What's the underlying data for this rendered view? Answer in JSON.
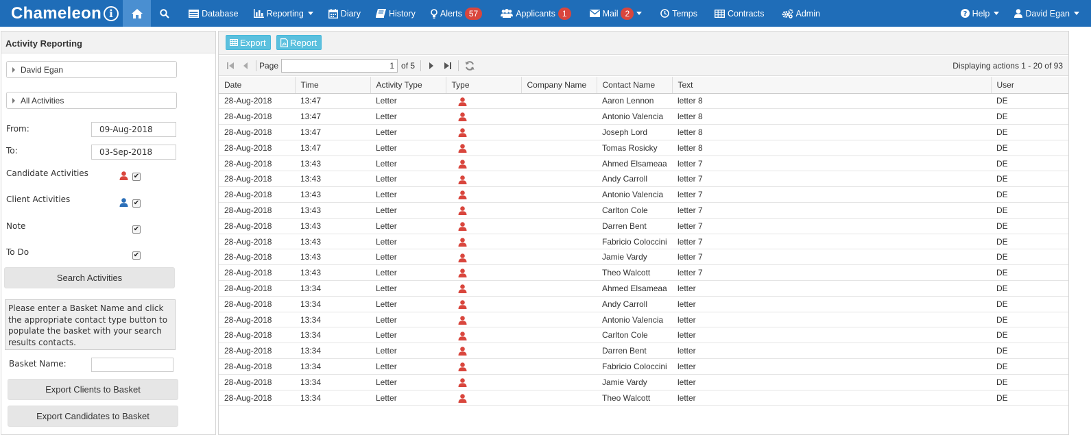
{
  "navbar": {
    "brand": "Chameleon",
    "brand_icon": "i",
    "items": [
      {
        "label": "Database"
      },
      {
        "label": "Reporting"
      },
      {
        "label": "Diary"
      },
      {
        "label": "History"
      },
      {
        "label": "Alerts",
        "badge": "57"
      },
      {
        "label": "Applicants",
        "badge": "1"
      },
      {
        "label": "Mail",
        "badge": "2"
      },
      {
        "label": "Temps"
      },
      {
        "label": "Contracts"
      },
      {
        "label": "Admin"
      }
    ],
    "help_label": "Help",
    "user_label": "David Egan"
  },
  "colors": {
    "navbar": "#1f6db8",
    "badge": "#d9463d",
    "candidate_icon": "#d9463d",
    "client_icon": "#2c6fb8",
    "toolbar_button": "#5bc0de"
  },
  "left_panel": {
    "title": "Activity Reporting",
    "user_combo": "David Egan",
    "activity_combo": "All Activities",
    "from_label": "From:",
    "from_value": "09-Aug-2018",
    "to_label": "To:",
    "to_value": "03-Sep-2018",
    "candidate_label": "Candidate Activities",
    "client_label": "Client Activities",
    "note_label": "Note",
    "todo_label": "To Do",
    "search_button": "Search Activities",
    "info_text": "Please enter a Basket Name and click the appropriate contact type button to populate the basket with your search results contacts.",
    "basket_label": "Basket Name:",
    "basket_value": "",
    "export_clients_button": "Export Clients to Basket",
    "export_candidates_button": "Export Candidates to Basket"
  },
  "toolbar": {
    "export_label": "Export",
    "report_label": "Report"
  },
  "pager": {
    "page_label": "Page",
    "page_value": "1",
    "of_label": "of 5",
    "display_text": "Displaying actions 1 - 20 of 93"
  },
  "grid": {
    "columns": [
      "Date",
      "Time",
      "Activity Type",
      "Type",
      "Company Name",
      "Contact Name",
      "Text",
      "User"
    ],
    "rows": [
      {
        "date": "28-Aug-2018",
        "time": "13:47",
        "activity": "Letter",
        "type": "candidate-icon",
        "company": "",
        "contact": "Aaron Lennon",
        "text": "letter 8",
        "user": "DE"
      },
      {
        "date": "28-Aug-2018",
        "time": "13:47",
        "activity": "Letter",
        "type": "candidate-icon",
        "company": "",
        "contact": "Antonio Valencia",
        "text": "letter 8",
        "user": "DE"
      },
      {
        "date": "28-Aug-2018",
        "time": "13:47",
        "activity": "Letter",
        "type": "candidate-icon",
        "company": "",
        "contact": "Joseph Lord",
        "text": "letter 8",
        "user": "DE"
      },
      {
        "date": "28-Aug-2018",
        "time": "13:47",
        "activity": "Letter",
        "type": "candidate-icon",
        "company": "",
        "contact": "Tomas Rosicky",
        "text": "letter 8",
        "user": "DE"
      },
      {
        "date": "28-Aug-2018",
        "time": "13:43",
        "activity": "Letter",
        "type": "candidate-icon",
        "company": "",
        "contact": "Ahmed Elsameaa",
        "text": "letter 7",
        "user": "DE"
      },
      {
        "date": "28-Aug-2018",
        "time": "13:43",
        "activity": "Letter",
        "type": "candidate-icon",
        "company": "",
        "contact": "Andy Carroll",
        "text": "letter 7",
        "user": "DE"
      },
      {
        "date": "28-Aug-2018",
        "time": "13:43",
        "activity": "Letter",
        "type": "candidate-icon",
        "company": "",
        "contact": "Antonio Valencia",
        "text": "letter 7",
        "user": "DE"
      },
      {
        "date": "28-Aug-2018",
        "time": "13:43",
        "activity": "Letter",
        "type": "candidate-icon",
        "company": "",
        "contact": "Carlton Cole",
        "text": "letter 7",
        "user": "DE"
      },
      {
        "date": "28-Aug-2018",
        "time": "13:43",
        "activity": "Letter",
        "type": "candidate-icon",
        "company": "",
        "contact": "Darren Bent",
        "text": "letter 7",
        "user": "DE"
      },
      {
        "date": "28-Aug-2018",
        "time": "13:43",
        "activity": "Letter",
        "type": "candidate-icon",
        "company": "",
        "contact": "Fabricio Coloccini",
        "text": "letter 7",
        "user": "DE"
      },
      {
        "date": "28-Aug-2018",
        "time": "13:43",
        "activity": "Letter",
        "type": "candidate-icon",
        "company": "",
        "contact": "Jamie Vardy",
        "text": "letter 7",
        "user": "DE"
      },
      {
        "date": "28-Aug-2018",
        "time": "13:43",
        "activity": "Letter",
        "type": "candidate-icon",
        "company": "",
        "contact": "Theo Walcott",
        "text": "letter 7",
        "user": "DE"
      },
      {
        "date": "28-Aug-2018",
        "time": "13:34",
        "activity": "Letter",
        "type": "candidate-icon",
        "company": "",
        "contact": "Ahmed Elsameaa",
        "text": "letter",
        "user": "DE"
      },
      {
        "date": "28-Aug-2018",
        "time": "13:34",
        "activity": "Letter",
        "type": "candidate-icon",
        "company": "",
        "contact": "Andy Carroll",
        "text": "letter",
        "user": "DE"
      },
      {
        "date": "28-Aug-2018",
        "time": "13:34",
        "activity": "Letter",
        "type": "candidate-icon",
        "company": "",
        "contact": "Antonio Valencia",
        "text": "letter",
        "user": "DE"
      },
      {
        "date": "28-Aug-2018",
        "time": "13:34",
        "activity": "Letter",
        "type": "candidate-icon",
        "company": "",
        "contact": "Carlton Cole",
        "text": "letter",
        "user": "DE"
      },
      {
        "date": "28-Aug-2018",
        "time": "13:34",
        "activity": "Letter",
        "type": "candidate-icon",
        "company": "",
        "contact": "Darren Bent",
        "text": "letter",
        "user": "DE"
      },
      {
        "date": "28-Aug-2018",
        "time": "13:34",
        "activity": "Letter",
        "type": "candidate-icon",
        "company": "",
        "contact": "Fabricio Coloccini",
        "text": "letter",
        "user": "DE"
      },
      {
        "date": "28-Aug-2018",
        "time": "13:34",
        "activity": "Letter",
        "type": "candidate-icon",
        "company": "",
        "contact": "Jamie Vardy",
        "text": "letter",
        "user": "DE"
      },
      {
        "date": "28-Aug-2018",
        "time": "13:34",
        "activity": "Letter",
        "type": "candidate-icon",
        "company": "",
        "contact": "Theo Walcott",
        "text": "letter",
        "user": "DE"
      }
    ]
  }
}
